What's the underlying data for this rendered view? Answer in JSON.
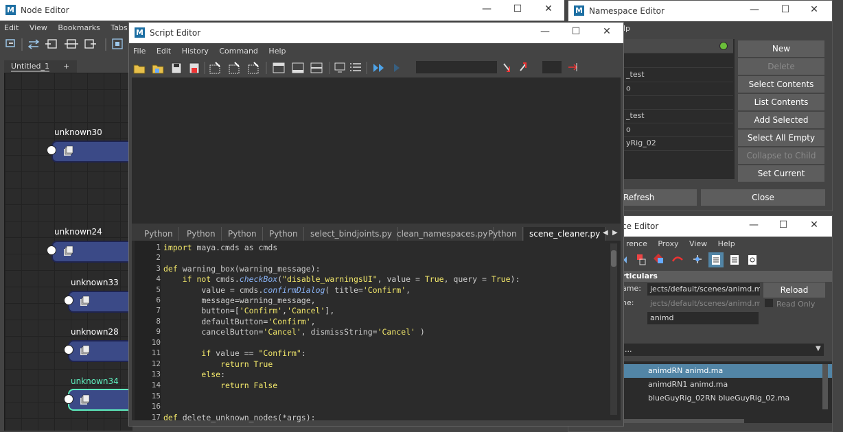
{
  "node_editor": {
    "title": "Node Editor",
    "menu": [
      "Edit",
      "View",
      "Bookmarks",
      "Tabs"
    ],
    "tab_label": "Untitled_1",
    "add_tab": "+",
    "nodes": [
      "unknown30",
      "unknown24",
      "unknown33",
      "unknown28",
      "unknown34"
    ]
  },
  "script_editor": {
    "title": "Script Editor",
    "menu": [
      "File",
      "Edit",
      "History",
      "Command",
      "Help"
    ],
    "tabs": [
      "Python",
      "Python",
      "Python",
      "Python",
      "select_bindjoints.py",
      "clean_namespaces.py",
      "Python",
      "scene_cleaner.py"
    ],
    "active_tab_index": 7,
    "line_numbers": [
      "1",
      "2",
      "3",
      "4",
      "5",
      "6",
      "7",
      "8",
      "9",
      "10",
      "11",
      "12",
      "13",
      "14",
      "15",
      "16",
      "17"
    ],
    "code": {
      "l1a": "import",
      "l1b": " maya.cmds as cmds",
      "l3a": "def",
      "l3b": " warning_box(warning_message):",
      "l4a": "    if not",
      "l4b": " cmds.",
      "l4c": "checkBox",
      "l4d": "(",
      "l4e": "\"disable_warningsUI\"",
      "l4f": ", value = ",
      "l4g": "True",
      "l4h": ", query = ",
      "l4i": "True",
      "l4j": "):",
      "l5a": "        value = cmds.",
      "l5b": "confirmDialog",
      "l5c": "( title=",
      "l5d": "'Confirm'",
      "l5e": ",",
      "l6": "        message=warning_message,",
      "l7a": "        button=[",
      "l7b": "'Confirm'",
      "l7c": ",",
      "l7d": "'Cancel'",
      "l7e": "],",
      "l8a": "        defaultButton=",
      "l8b": "'Confirm'",
      "l8c": ",",
      "l9a": "        cancelButton=",
      "l9b": "'Cancel'",
      "l9c": ", dismissString=",
      "l9d": "'Cancel'",
      "l9e": " )",
      "l11a": "        if",
      "l11b": " value == ",
      "l11c": "\"Confirm\"",
      "l11d": ":",
      "l12a": "            return True",
      "l13a": "        else",
      "l13b": ":",
      "l14a": "            return False",
      "l17a": "def",
      "l17b": " delete_unknown_nodes(*args):"
    }
  },
  "namespace_editor": {
    "title": "Namespace Editor",
    "menu_partial": "lp",
    "list_rows": [
      "",
      "",
      "_test",
      "o",
      "",
      "_test",
      "o",
      "yRig_02",
      ""
    ],
    "buttons": [
      "New",
      "Delete",
      "Select Contents",
      "List Contents",
      "Add Selected",
      "Select All Empty",
      "Collapse to Child",
      "Set Current"
    ],
    "disabled_buttons": [
      "Delete",
      "Collapse to Child"
    ],
    "refresh": "Refresh",
    "close": "Close"
  },
  "reference_editor": {
    "title_partial": "ce Editor",
    "menu": [
      "rence",
      "Proxy",
      "View",
      "Help"
    ],
    "section": "rticulars",
    "label1": "ame:",
    "label2": "ne:",
    "file_name": "jects/default/scenes/animd.ma",
    "unresolved_name": "jects/default/scenes/animd.ma",
    "namespace": "animd",
    "reload": "Reload",
    "read_only": "Read Only",
    "dropdown": "...",
    "rows": [
      "animdRN animd.ma",
      "animdRN1 animd.ma",
      "blueGuyRig_02RN blueGuyRig_02.ma"
    ],
    "selected_row": 0
  },
  "window_controls": {
    "minimize": "—",
    "maximize": "☐",
    "close": "✕"
  },
  "colors": {
    "node_blue": "#3b4a87",
    "node_selected_border": "#5ff0c0",
    "selected_row": "#5285a6",
    "status_green": "#6bbf3a"
  }
}
